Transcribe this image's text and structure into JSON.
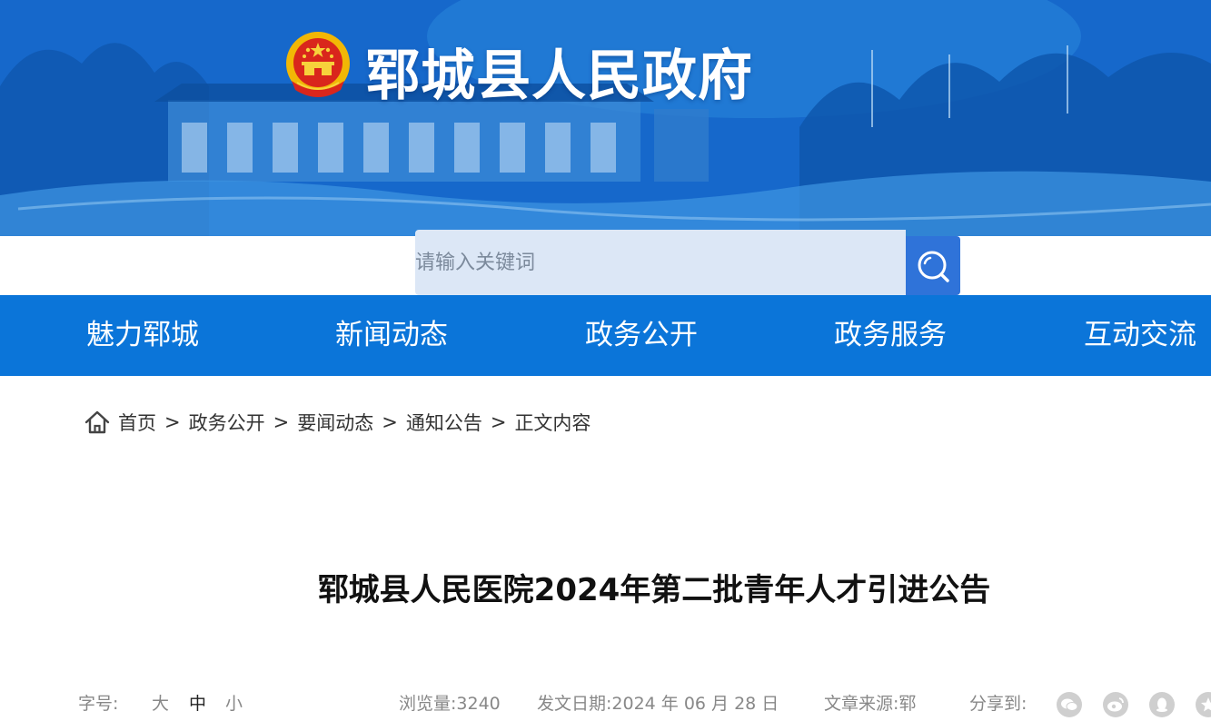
{
  "header": {
    "site_title": "郓城县人民政府"
  },
  "search": {
    "placeholder": "请输入关键词"
  },
  "nav": {
    "items": [
      "魅力郓城",
      "新闻动态",
      "政务公开",
      "政务服务",
      "互动交流"
    ]
  },
  "breadcrumb": {
    "items": [
      "首页",
      "政务公开",
      "要闻动态",
      "通知公告",
      "正文内容"
    ],
    "separator": ">"
  },
  "article": {
    "title": "郓城县人民医院2024年第二批青年人才引进公告"
  },
  "meta": {
    "font_size_label": "字号:",
    "font_size_large": "大",
    "font_size_medium": "中",
    "font_size_small": "小",
    "views": "浏览量:3240",
    "publish_date": "发文日期:2024 年 06 月 28 日",
    "source": "文章来源:郓",
    "share_label": "分享到:"
  },
  "share": {
    "icons": [
      "wechat-icon",
      "weibo-icon",
      "qq-icon",
      "qzone-icon"
    ]
  },
  "colors": {
    "nav_bg": "#0b75d9",
    "search_btn": "#2f73d9",
    "search_bg": "#dce7f6",
    "banner": "#1566c9"
  }
}
